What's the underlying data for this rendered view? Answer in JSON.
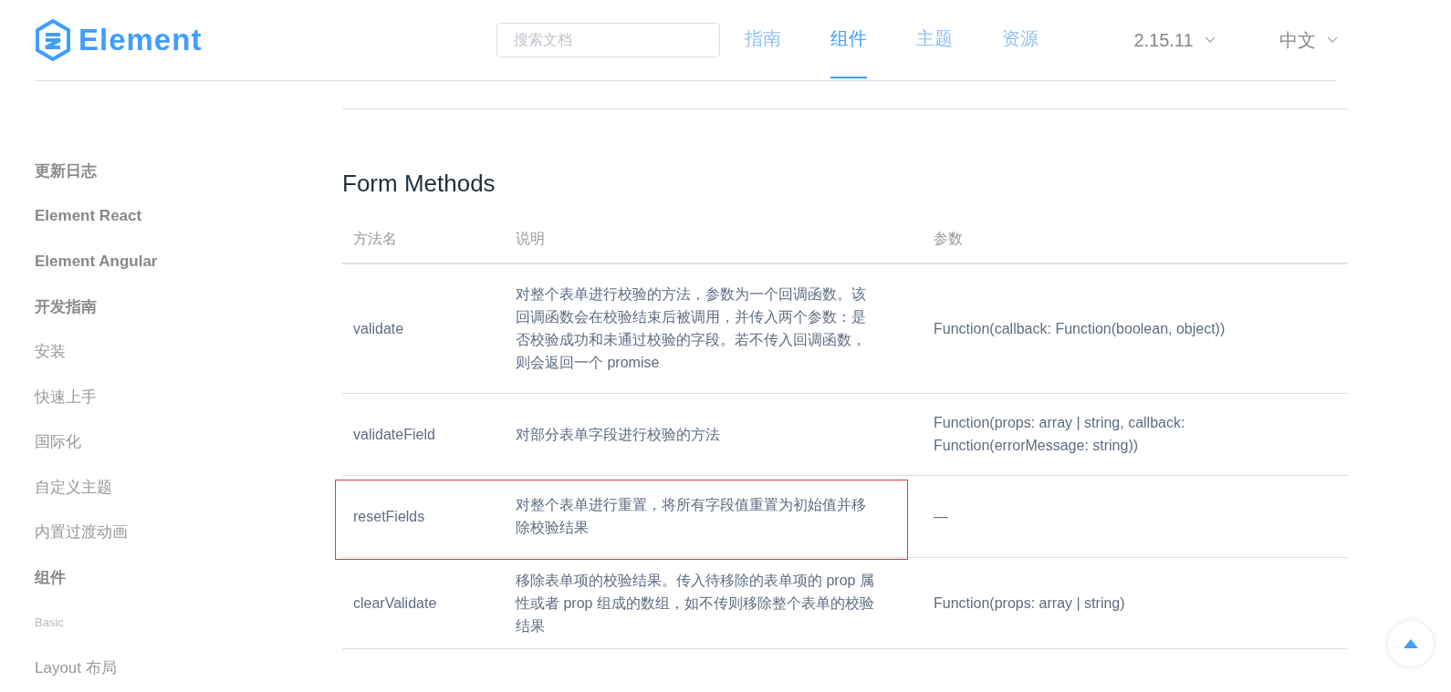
{
  "header": {
    "logo_text": "Element",
    "search": {
      "placeholder": "搜索文档"
    },
    "nav": [
      {
        "label": "指南",
        "selected": false
      },
      {
        "label": "组件",
        "selected": true
      },
      {
        "label": "主题",
        "selected": false
      },
      {
        "label": "资源",
        "selected": false
      }
    ],
    "version": "2.15.11",
    "language": "中文"
  },
  "sidebar": {
    "items": [
      {
        "kind": "group",
        "label": "更新日志"
      },
      {
        "kind": "group",
        "label": "Element React"
      },
      {
        "kind": "group",
        "label": "Element Angular"
      },
      {
        "kind": "group",
        "label": "开发指南"
      },
      {
        "kind": "link",
        "label": "安装"
      },
      {
        "kind": "link",
        "label": "快速上手"
      },
      {
        "kind": "link",
        "label": "国际化"
      },
      {
        "kind": "link",
        "label": "自定义主题"
      },
      {
        "kind": "link",
        "label": "内置过渡动画"
      },
      {
        "kind": "group",
        "label": "组件"
      },
      {
        "kind": "section",
        "label": "Basic"
      },
      {
        "kind": "link",
        "label": "Layout 布局"
      }
    ]
  },
  "content": {
    "title": "Form Methods",
    "table": {
      "columns": [
        "方法名",
        "说明",
        "参数"
      ],
      "rows": [
        {
          "cells": [
            "validate",
            "对整个表单进行校验的方法，参数为一个回调函数。该回调函数会在校验结束后被调用，并传入两个参数：是否校验成功和未通过校验的字段。若不传入回调函数，则会返回一个 promise",
            "Function(callback: Function(boolean, object))"
          ],
          "annotated": false
        },
        {
          "cells": [
            "validateField",
            "对部分表单字段进行校验的方法",
            "Function(props: array | string, callback: Function(errorMessage: string))"
          ],
          "annotated": false
        },
        {
          "cells": [
            "resetFields",
            "对整个表单进行重置，将所有字段值重置为初始值并移除校验结果",
            "—"
          ],
          "annotated": true
        },
        {
          "cells": [
            "clearValidate",
            "移除表单项的校验结果。传入待移除的表单项的 prop 属性或者 prop 组成的数组，如不传则移除整个表单的校验结果",
            "Function(props: array | string)"
          ],
          "annotated": false
        }
      ]
    }
  }
}
